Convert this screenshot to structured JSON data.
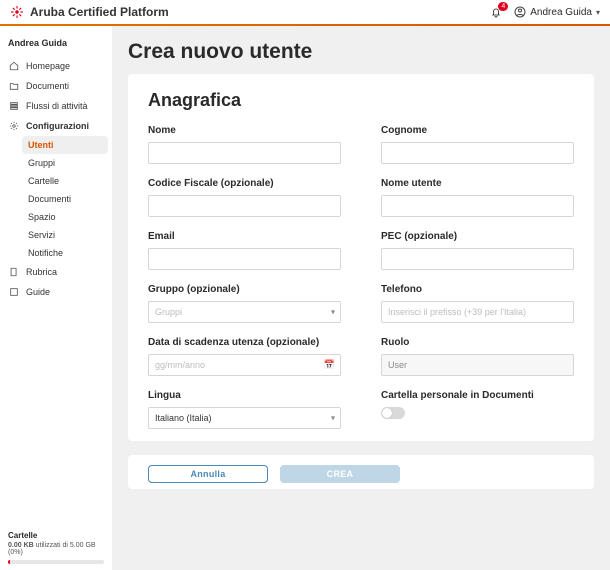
{
  "header": {
    "brand": "Aruba Certified Platform",
    "notification_count": "4",
    "user_name": "Andrea Guida"
  },
  "sidebar": {
    "user_name": "Andrea Guida",
    "items": [
      {
        "icon": "home-icon",
        "label": "Homepage"
      },
      {
        "icon": "document-icon",
        "label": "Documenti"
      },
      {
        "icon": "activity-icon",
        "label": "Flussi di attività"
      },
      {
        "icon": "gear-icon",
        "label": "Configurazioni",
        "expanded": true
      }
    ],
    "config_children": [
      {
        "label": "Utenti",
        "active": true
      },
      {
        "label": "Gruppi"
      },
      {
        "label": "Cartelle"
      },
      {
        "label": "Documenti"
      },
      {
        "label": "Spazio"
      },
      {
        "label": "Servizi"
      },
      {
        "label": "Notifiche"
      }
    ],
    "bottom_items": [
      {
        "icon": "book-icon",
        "label": "Rubrica"
      },
      {
        "icon": "guide-icon",
        "label": "Guide"
      }
    ],
    "storage": {
      "heading": "Cartelle",
      "used": "0.00 KB",
      "middle": "utilizzati di",
      "total": "5.00 GB",
      "percent": "(0%)"
    }
  },
  "page": {
    "title": "Crea nuovo utente",
    "section": "Anagrafica",
    "fields": {
      "nome": "Nome",
      "cognome": "Cognome",
      "cf": "Codice Fiscale (opzionale)",
      "nome_utente": "Nome utente",
      "email": "Email",
      "pec": "PEC (opzionale)",
      "gruppo": "Gruppo (opzionale)",
      "gruppo_placeholder": "Gruppi",
      "telefono": "Telefono",
      "telefono_placeholder": "Inserisci il prefisso (+39 per l'Italia)",
      "data_scad": "Data di scadenza utenza (opzionale)",
      "data_placeholder": "gg/mm/anno",
      "ruolo": "Ruolo",
      "ruolo_value": "User",
      "lingua": "Lingua",
      "lingua_value": "Italiano (Italia)",
      "cartella_personale": "Cartella personale in Documenti"
    },
    "actions": {
      "cancel": "Annulla",
      "create": "CREA"
    }
  }
}
